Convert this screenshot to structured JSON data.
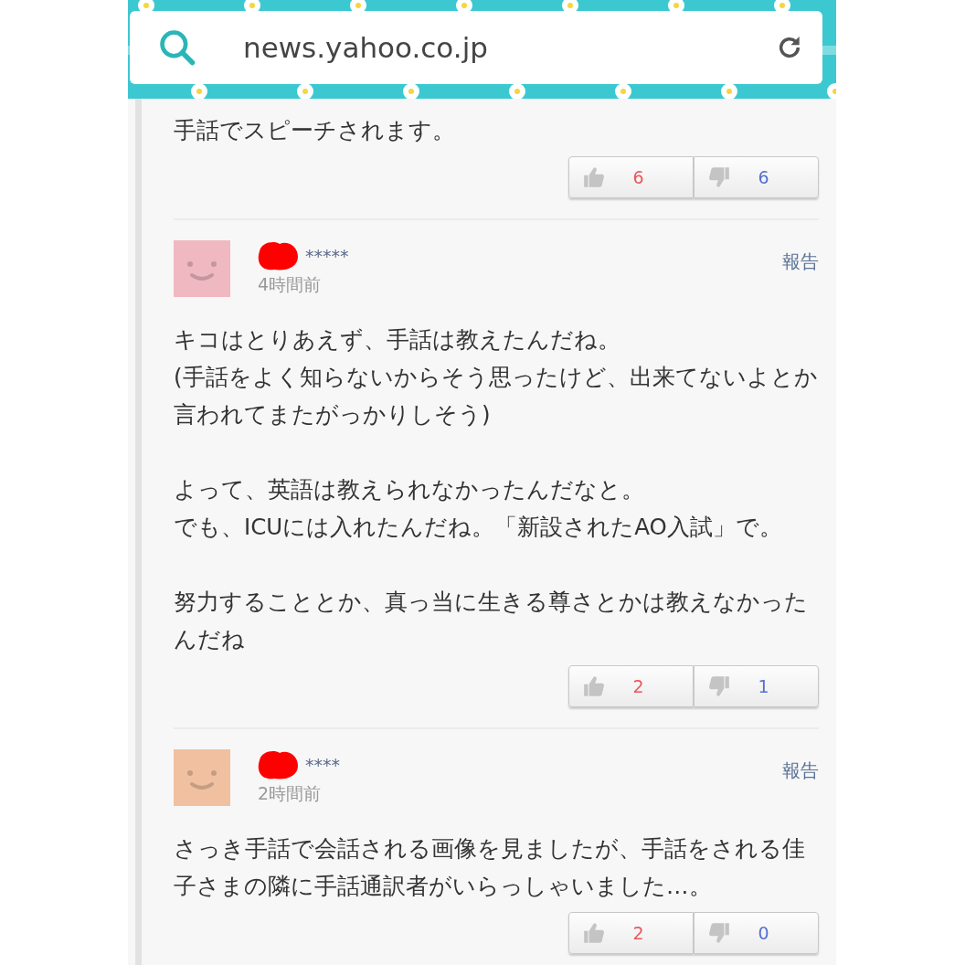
{
  "address_bar": {
    "url": "news.yahoo.co.jp"
  },
  "comments": [
    {
      "paragraphs": [
        [
          "手話でスピーチされます。"
        ]
      ],
      "likes": "6",
      "dislikes": "6"
    },
    {
      "color": "#f0b8c0",
      "name": "*****",
      "redacted": true,
      "time": "4時間前",
      "report": "報告",
      "paragraphs": [
        [
          "キコはとりあえず、手話は教えたんだね。",
          "(手話をよく知らないからそう思ったけど、出来てないよとか言われてまたがっかりしそう)"
        ],
        [
          "よって、英語は教えられなかったんだなと。",
          "でも、ICUには入れたんだね。「新設されたAO入試」で。"
        ],
        [
          "努力することとか、真っ当に生きる尊さとかは教えなかったんだね"
        ]
      ],
      "likes": "2",
      "dislikes": "1"
    },
    {
      "color": "#f0c0a0",
      "name": "****",
      "redacted": true,
      "time": "2時間前",
      "report": "報告",
      "paragraphs": [
        [
          "さっき手話で会話される画像を見ましたが、手話をされる佳子さまの隣に手話通訳者がいらっしゃいました…。"
        ]
      ],
      "likes": "2",
      "dislikes": "0"
    }
  ]
}
